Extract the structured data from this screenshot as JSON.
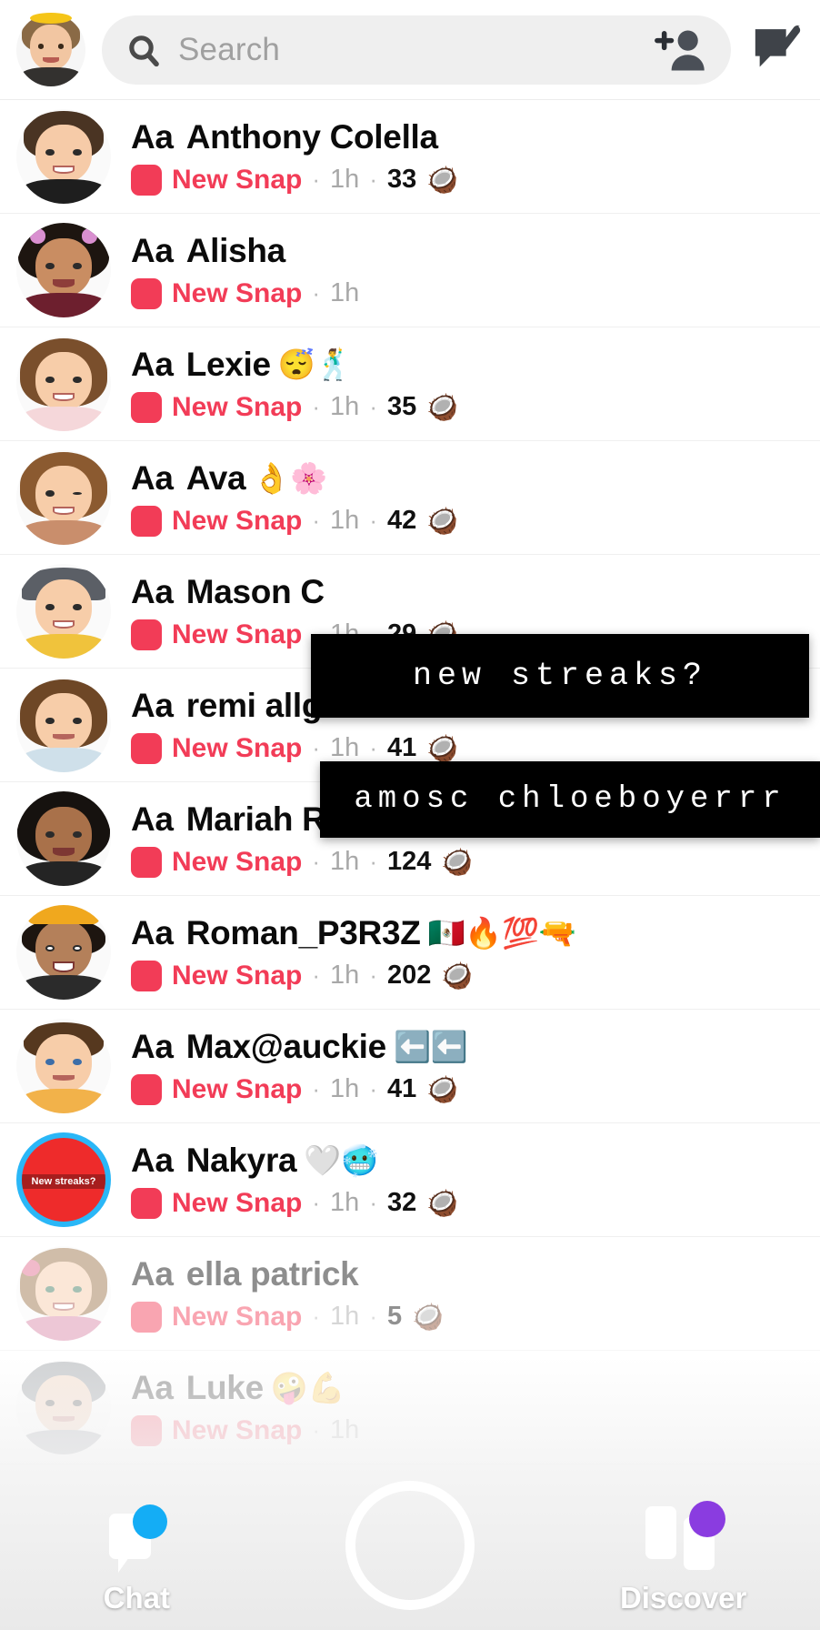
{
  "header": {
    "profile_avatar_name": "my-bitmoji-avatar",
    "search_placeholder": "Search",
    "search_value": "",
    "search_icon": "search-icon",
    "add_friend_icon": "add-friend-icon",
    "new_chat_icon": "new-chat-icon"
  },
  "chats": [
    {
      "prefix": "Aa",
      "name": "Anthony Colella",
      "emoji": "",
      "status": "New Snap",
      "time": "1h",
      "streak": "33",
      "streak_emoji": "🥥",
      "avatar": "bitmoji-anthony",
      "faded": false
    },
    {
      "prefix": "Aa",
      "name": "Alisha",
      "emoji": "",
      "status": "New Snap",
      "time": "1h",
      "streak": "",
      "streak_emoji": "",
      "avatar": "bitmoji-alisha",
      "faded": false
    },
    {
      "prefix": "Aa",
      "name": "Lexie",
      "emoji": "😴🕺",
      "status": "New Snap",
      "time": "1h",
      "streak": "35",
      "streak_emoji": "🥥",
      "avatar": "bitmoji-lexie",
      "faded": false
    },
    {
      "prefix": "Aa",
      "name": "Ava",
      "emoji": "👌🌸",
      "status": "New Snap",
      "time": "1h",
      "streak": "42",
      "streak_emoji": "🥥",
      "avatar": "bitmoji-ava",
      "faded": false
    },
    {
      "prefix": "Aa",
      "name": "Mason C",
      "emoji": "",
      "status": "New Snap",
      "time": "1h",
      "streak": "29",
      "streak_emoji": "🥥",
      "avatar": "bitmoji-mason",
      "faded": false
    },
    {
      "prefix": "Aa",
      "name": "remi allgood",
      "emoji": "",
      "status": "New Snap",
      "time": "1h",
      "streak": "41",
      "streak_emoji": "🥥",
      "avatar": "bitmoji-remi",
      "faded": false
    },
    {
      "prefix": "Aa",
      "name": "Mariah R",
      "emoji": "",
      "status": "New Snap",
      "time": "1h",
      "streak": "124",
      "streak_emoji": "🥥",
      "avatar": "bitmoji-mariah",
      "faded": false
    },
    {
      "prefix": "Aa",
      "name": "Roman_P3R3Z",
      "emoji": "🇲🇽🔥💯🔫",
      "status": "New Snap",
      "time": "1h",
      "streak": "202",
      "streak_emoji": "🥥",
      "avatar": "bitmoji-roman",
      "faded": false
    },
    {
      "prefix": "Aa",
      "name": "Max@auckie",
      "emoji": "⬅️⬅️",
      "status": "New Snap",
      "time": "1h",
      "streak": "41",
      "streak_emoji": "🥥",
      "avatar": "bitmoji-max",
      "faded": false
    },
    {
      "prefix": "Aa",
      "name": "Nakyra",
      "emoji": "🤍🥶",
      "status": "New Snap",
      "time": "1h",
      "streak": "32",
      "streak_emoji": "🥥",
      "avatar": "story-ring-nakyra",
      "faded": false
    },
    {
      "prefix": "Aa",
      "name": "ella patrick",
      "emoji": "",
      "status": "New Snap",
      "time": "1h",
      "streak": "5",
      "streak_emoji": "🥥",
      "avatar": "bitmoji-ella",
      "faded": true
    },
    {
      "prefix": "Aa",
      "name": "Luke",
      "emoji": "🤪💪",
      "status": "New Snap",
      "time": "1h",
      "streak": "",
      "streak_emoji": "",
      "avatar": "bitmoji-luke",
      "faded": true
    }
  ],
  "overlays": [
    {
      "text": "new streaks?",
      "id": "caption-new-streaks"
    },
    {
      "text": "amosc chloeboyerrr",
      "id": "caption-usernames"
    }
  ],
  "nav": {
    "chat_label": "Chat",
    "camera_label": "",
    "discover_label": "Discover"
  },
  "colors": {
    "snap_red": "#f23c57",
    "accent_blue": "#14adf5",
    "accent_purple": "#8a3ce0",
    "story_ring": "#2ab7f7"
  }
}
